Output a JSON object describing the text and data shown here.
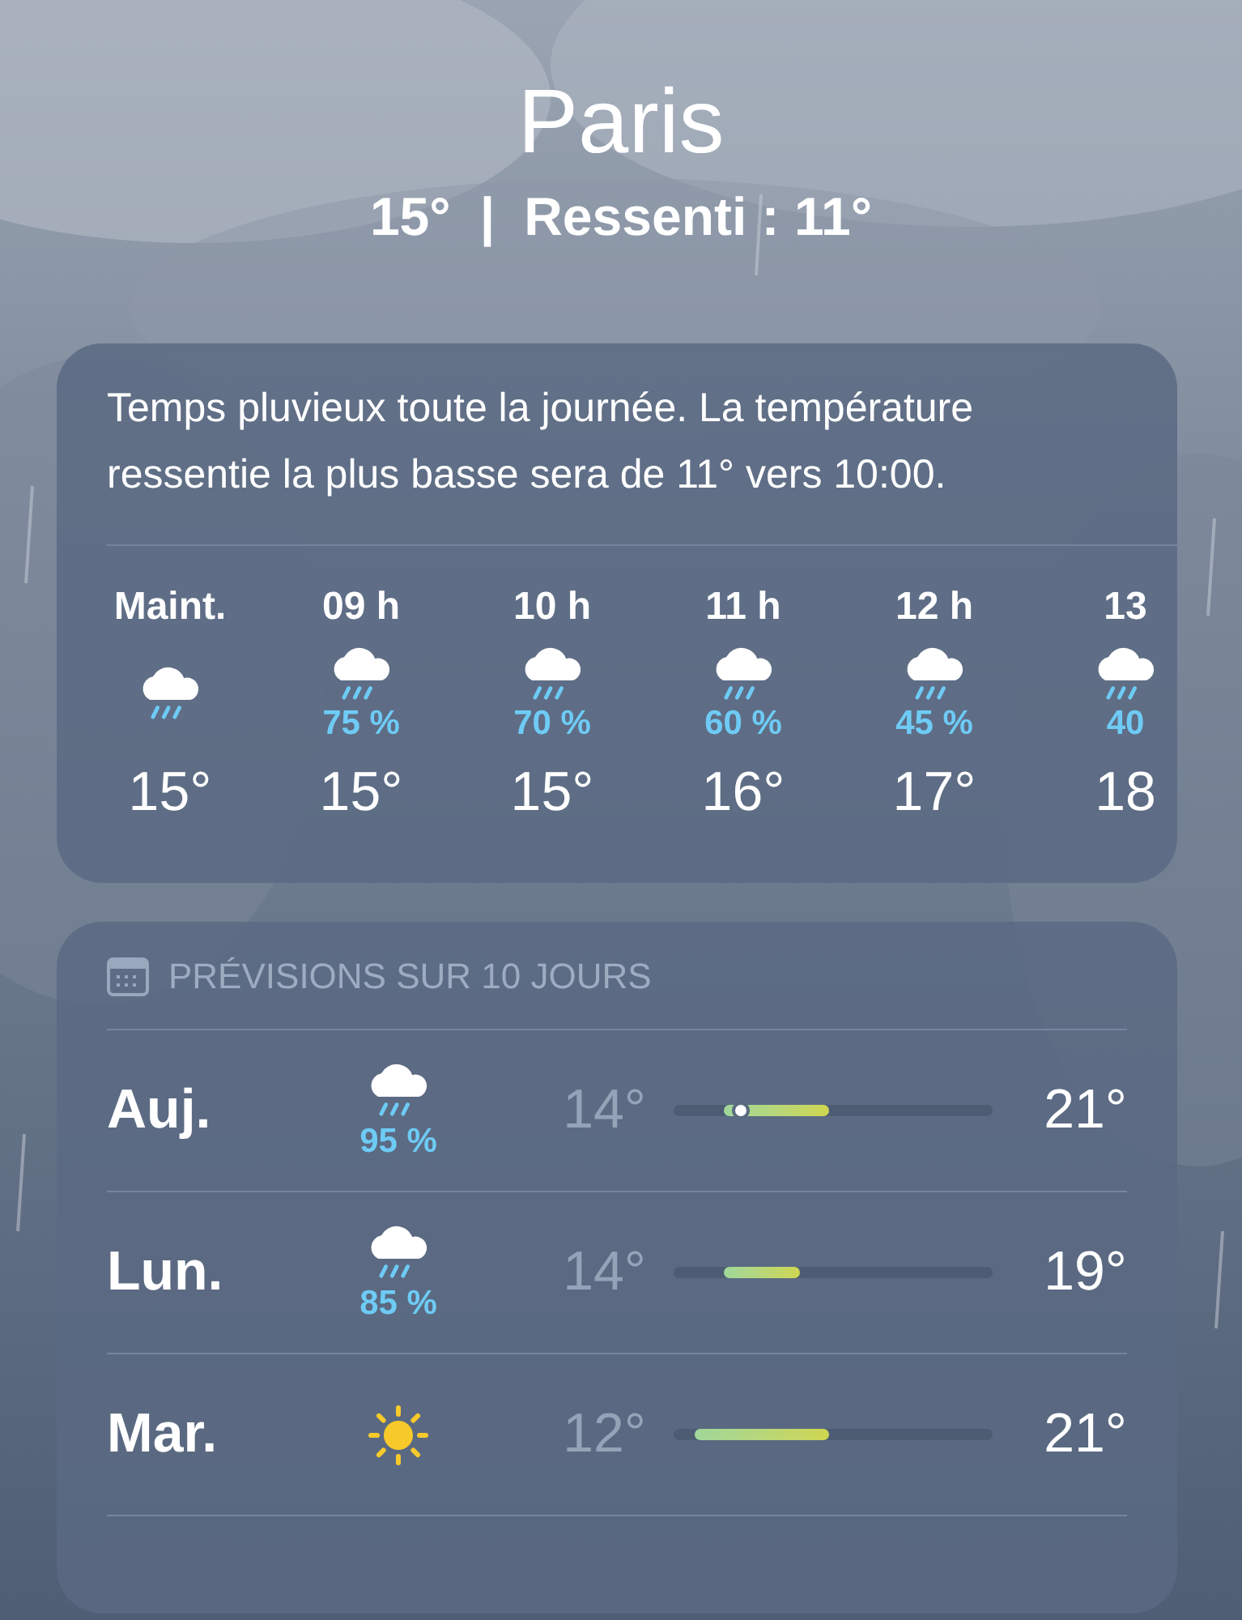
{
  "city": "Paris",
  "current": {
    "temp": "15°",
    "separator": "|",
    "feels_like": "Ressenti : 11°"
  },
  "summary": "Temps pluvieux toute la journée. La température ressentie la plus basse sera de 11° vers 10:00.",
  "hourly": [
    {
      "label": "Maint.",
      "kind": "rain",
      "temp": "15°"
    },
    {
      "label": "09 h",
      "kind": "rain",
      "chance": "75 %",
      "temp": "15°"
    },
    {
      "label": "10 h",
      "kind": "rain",
      "chance": "70 %",
      "temp": "15°"
    },
    {
      "label": "11 h",
      "kind": "rain",
      "chance": "60 %",
      "temp": "16°"
    },
    {
      "label": "12 h",
      "kind": "rain",
      "chance": "45 %",
      "temp": "17°"
    },
    {
      "label": "13",
      "kind": "rain",
      "chance": "40",
      "temp": "18"
    }
  ],
  "forecast": {
    "title": "PRÉVISIONS SUR 10 JOURS",
    "days": [
      {
        "day": "Auj.",
        "kind": "rain",
        "chance": "95 %",
        "low": "14°",
        "high": "21°",
        "shows_current": true
      },
      {
        "day": "Lun.",
        "kind": "rain",
        "chance": "85 %",
        "low": "14°",
        "high": "19°",
        "shows_current": false
      },
      {
        "day": "Mar.",
        "kind": "sun",
        "low": "12°",
        "high": "21°",
        "shows_current": false
      }
    ]
  }
}
